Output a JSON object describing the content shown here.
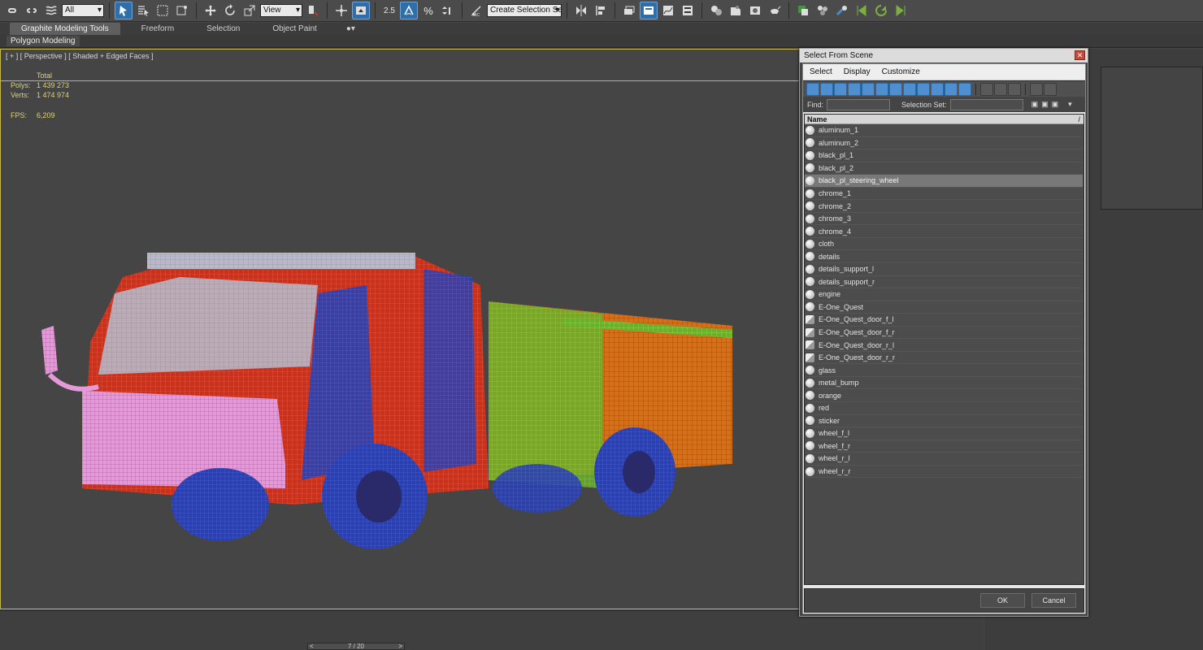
{
  "toolbar": {
    "filter_value": "All",
    "refcoord_value": "View",
    "snap_angle": "2.5",
    "snap_percent": "%",
    "selection_set_value": "Create Selection Se"
  },
  "ribbon": {
    "tabs": [
      {
        "label": "Graphite Modeling Tools",
        "active": true
      },
      {
        "label": "Freeform"
      },
      {
        "label": "Selection"
      },
      {
        "label": "Object Paint"
      }
    ],
    "panel_label": "Polygon Modeling"
  },
  "viewport": {
    "label": "[ + ] [ Perspective ] [ Shaded + Edged Faces ]",
    "stats_header": "Total",
    "polys_label": "Polys:",
    "polys_value": "1 439 273",
    "verts_label": "Verts:",
    "verts_value": "1 474 974",
    "fps_label": "FPS:",
    "fps_value": "6,209"
  },
  "timeline": {
    "frame_readout": "7 / 20"
  },
  "dialog": {
    "title": "Select From Scene",
    "menu": [
      "Select",
      "Display",
      "Customize"
    ],
    "find_label": "Find:",
    "selection_set_label": "Selection Set:",
    "column_header": "Name",
    "items": [
      {
        "name": "aluminum_1",
        "type": "object"
      },
      {
        "name": "aluminum_2",
        "type": "object"
      },
      {
        "name": "black_pl_1",
        "type": "object"
      },
      {
        "name": "black_pl_2",
        "type": "object"
      },
      {
        "name": "black_pl_steering_wheel",
        "type": "object",
        "selected": true
      },
      {
        "name": "chrome_1",
        "type": "object"
      },
      {
        "name": "chrome_2",
        "type": "object"
      },
      {
        "name": "chrome_3",
        "type": "object"
      },
      {
        "name": "chrome_4",
        "type": "object"
      },
      {
        "name": "cloth",
        "type": "object"
      },
      {
        "name": "details",
        "type": "object"
      },
      {
        "name": "details_support_l",
        "type": "object"
      },
      {
        "name": "details_support_r",
        "type": "object"
      },
      {
        "name": "engine",
        "type": "object"
      },
      {
        "name": "E-One_Quest",
        "type": "object"
      },
      {
        "name": "E-One_Quest_door_f_l",
        "type": "group"
      },
      {
        "name": "E-One_Quest_door_f_r",
        "type": "group"
      },
      {
        "name": "E-One_Quest_door_r_l",
        "type": "group"
      },
      {
        "name": "E-One_Quest_door_r_r",
        "type": "group"
      },
      {
        "name": "glass",
        "type": "object"
      },
      {
        "name": "metal_bump",
        "type": "object"
      },
      {
        "name": "orange",
        "type": "object"
      },
      {
        "name": "red",
        "type": "object"
      },
      {
        "name": "sticker",
        "type": "object"
      },
      {
        "name": "wheel_f_l",
        "type": "object"
      },
      {
        "name": "wheel_f_r",
        "type": "object"
      },
      {
        "name": "wheel_r_l",
        "type": "object"
      },
      {
        "name": "wheel_r_r",
        "type": "object"
      }
    ],
    "ok_label": "OK",
    "cancel_label": "Cancel"
  },
  "colors": {
    "viewport_border": "#c9b84a",
    "stats_text": "#e0d36a",
    "truck_red": "#c8321c",
    "truck_orange": "#d4701c",
    "wire_blue": "#2a3fb0",
    "wire_pink": "#e49ad8",
    "wire_green": "#6ab02a"
  }
}
